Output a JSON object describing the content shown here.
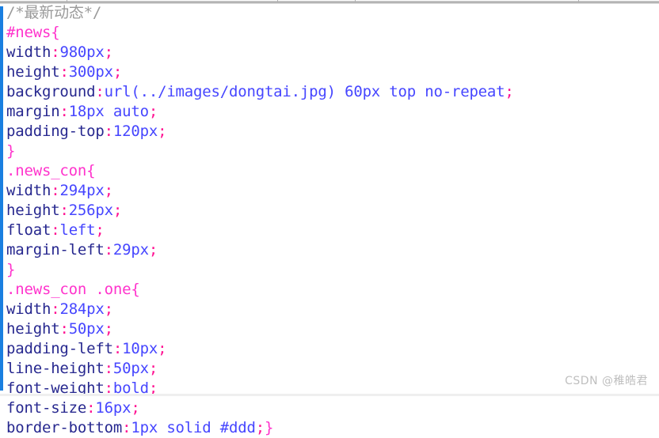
{
  "document": {
    "language": "CSS",
    "background_color": "#ffffff",
    "accent_bar_color": "#1a7fe0"
  },
  "syntax_colors": {
    "comment": "#9a9a9a",
    "selector": "#ff33cc",
    "brace": "#ff33cc",
    "property": "#27288f",
    "punctuation": "#ff1493",
    "value": "#4646ff"
  },
  "code": {
    "lines": [
      {
        "tokens": [
          {
            "type": "comment",
            "text": "/*最新动态*/"
          }
        ]
      },
      {
        "tokens": [
          {
            "type": "selector",
            "text": "#news"
          },
          {
            "type": "brace",
            "text": "{"
          }
        ]
      },
      {
        "tokens": [
          {
            "type": "prop",
            "text": "width"
          },
          {
            "type": "punct",
            "text": ":"
          },
          {
            "type": "value",
            "text": "980px"
          },
          {
            "type": "punct",
            "text": ";"
          }
        ]
      },
      {
        "tokens": [
          {
            "type": "prop",
            "text": "height"
          },
          {
            "type": "punct",
            "text": ":"
          },
          {
            "type": "value",
            "text": "300px"
          },
          {
            "type": "punct",
            "text": ";"
          }
        ]
      },
      {
        "tokens": [
          {
            "type": "prop",
            "text": "background"
          },
          {
            "type": "punct",
            "text": ":"
          },
          {
            "type": "value",
            "text": "url(../images/dongtai.jpg) 60px top no-repeat"
          },
          {
            "type": "punct",
            "text": ";"
          }
        ]
      },
      {
        "tokens": [
          {
            "type": "prop",
            "text": "margin"
          },
          {
            "type": "punct",
            "text": ":"
          },
          {
            "type": "value",
            "text": "18px auto"
          },
          {
            "type": "punct",
            "text": ";"
          }
        ]
      },
      {
        "tokens": [
          {
            "type": "prop",
            "text": "padding-top"
          },
          {
            "type": "punct",
            "text": ":"
          },
          {
            "type": "value",
            "text": "120px"
          },
          {
            "type": "punct",
            "text": ";"
          }
        ]
      },
      {
        "tokens": [
          {
            "type": "brace",
            "text": "}"
          }
        ]
      },
      {
        "tokens": [
          {
            "type": "selector",
            "text": ".news_con"
          },
          {
            "type": "brace",
            "text": "{"
          }
        ]
      },
      {
        "tokens": [
          {
            "type": "prop",
            "text": "width"
          },
          {
            "type": "punct",
            "text": ":"
          },
          {
            "type": "value",
            "text": "294px"
          },
          {
            "type": "punct",
            "text": ";"
          }
        ]
      },
      {
        "tokens": [
          {
            "type": "prop",
            "text": "height"
          },
          {
            "type": "punct",
            "text": ":"
          },
          {
            "type": "value",
            "text": "256px"
          },
          {
            "type": "punct",
            "text": ";"
          }
        ]
      },
      {
        "tokens": [
          {
            "type": "prop",
            "text": "float"
          },
          {
            "type": "punct",
            "text": ":"
          },
          {
            "type": "value",
            "text": "left"
          },
          {
            "type": "punct",
            "text": ";"
          }
        ]
      },
      {
        "tokens": [
          {
            "type": "prop",
            "text": "margin-left"
          },
          {
            "type": "punct",
            "text": ":"
          },
          {
            "type": "value",
            "text": "29px"
          },
          {
            "type": "punct",
            "text": ";"
          }
        ]
      },
      {
        "tokens": [
          {
            "type": "brace",
            "text": "}"
          }
        ]
      },
      {
        "tokens": [
          {
            "type": "selector",
            "text": ".news_con .one"
          },
          {
            "type": "brace",
            "text": "{"
          }
        ]
      },
      {
        "tokens": [
          {
            "type": "prop",
            "text": "width"
          },
          {
            "type": "punct",
            "text": ":"
          },
          {
            "type": "value",
            "text": "284px"
          },
          {
            "type": "punct",
            "text": ";"
          }
        ]
      },
      {
        "tokens": [
          {
            "type": "prop",
            "text": "height"
          },
          {
            "type": "punct",
            "text": ":"
          },
          {
            "type": "value",
            "text": "50px"
          },
          {
            "type": "punct",
            "text": ";"
          }
        ]
      },
      {
        "tokens": [
          {
            "type": "prop",
            "text": "padding-left"
          },
          {
            "type": "punct",
            "text": ":"
          },
          {
            "type": "value",
            "text": "10px"
          },
          {
            "type": "punct",
            "text": ";"
          }
        ]
      },
      {
        "tokens": [
          {
            "type": "prop",
            "text": "line-height"
          },
          {
            "type": "punct",
            "text": ":"
          },
          {
            "type": "value",
            "text": "50px"
          },
          {
            "type": "punct",
            "text": ";"
          }
        ]
      },
      {
        "tokens": [
          {
            "type": "prop",
            "text": "font-weight"
          },
          {
            "type": "punct",
            "text": ":"
          },
          {
            "type": "value",
            "text": "bold"
          },
          {
            "type": "punct",
            "text": ";"
          }
        ]
      },
      {
        "tokens": [
          {
            "type": "prop",
            "text": "font-size"
          },
          {
            "type": "punct",
            "text": ":"
          },
          {
            "type": "value",
            "text": "16px"
          },
          {
            "type": "punct",
            "text": ";"
          }
        ]
      },
      {
        "tokens": [
          {
            "type": "prop",
            "text": "border-bottom"
          },
          {
            "type": "punct",
            "text": ":"
          },
          {
            "type": "value",
            "text": "1px solid #ddd"
          },
          {
            "type": "punct",
            "text": ";"
          },
          {
            "type": "brace",
            "text": "}"
          }
        ]
      }
    ]
  },
  "watermark": {
    "text": "CSDN @稚皓君"
  },
  "ruler": {
    "tick_positions": [
      84,
      350,
      448,
      730
    ]
  }
}
